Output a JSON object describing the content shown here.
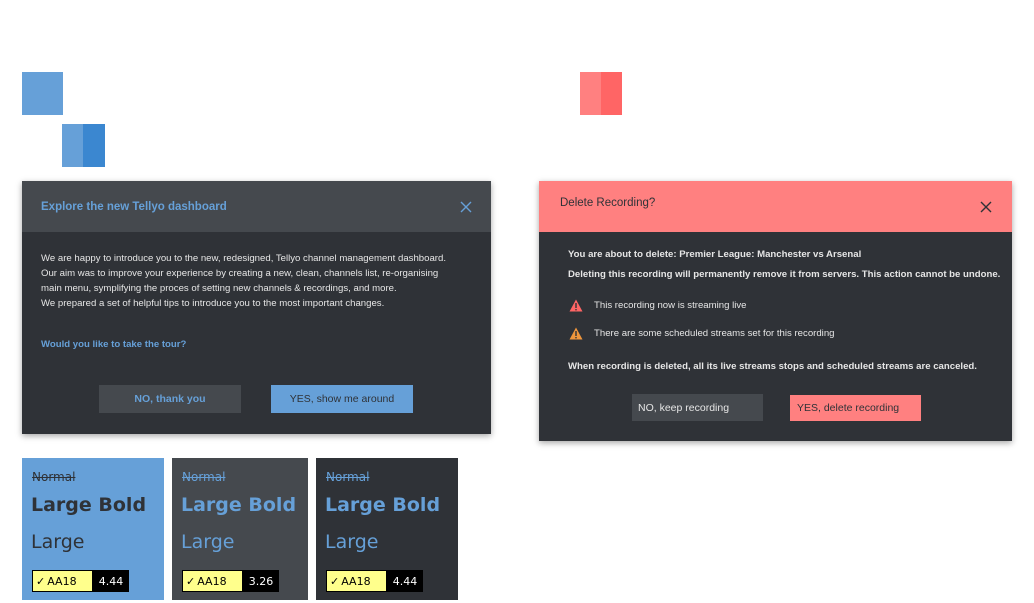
{
  "colors": {
    "accent_blue": "#66a0d8",
    "accent_blue_dark": "#3b87d0",
    "accent_red": "#ff8080",
    "accent_red_dark": "#ff6565",
    "dialog_bg": "#2f3237",
    "dialog_header_bg": "#45494e",
    "button_dark": "#45494e",
    "sample_dark": "#2f3237"
  },
  "tour_dialog": {
    "title": "Explore the new Tellyo dashboard",
    "close_icon": "close-icon",
    "paragraph_lines": [
      "We are happy to introduce you to the new, redesigned, Tellyo channel management dashboard.",
      "Our aim was to improve your experience by creating a new, clean, channels list, re-organising",
      "main menu, symplifying the proces of setting new channels & recordings, and more.",
      "We prepared a set of helpful tips to introduce you to the most important changes."
    ],
    "question": "Would you like to take the tour?",
    "decline_label": "NO, thank you",
    "accept_label": "YES, show me around"
  },
  "delete_dialog": {
    "title": "Delete Recording?",
    "close_icon": "close-icon",
    "line_1": "You are about to delete: Premier League: Manchester vs Arsenal",
    "line_2": "Deleting this recording will permanently remove it from servers. This action cannot be undone.",
    "warnings": [
      {
        "icon": "warning-icon-red",
        "text": "This recording now is streaming live"
      },
      {
        "icon": "warning-icon-orange",
        "text": "There are some scheduled streams set for this recording"
      }
    ],
    "note": "When recording is deleted, all its live streams stops and scheduled streams are canceled.",
    "cancel_label": "NO, keep recording",
    "confirm_label": "YES, delete recording"
  },
  "contrast_samples": [
    {
      "normal": "Normal",
      "large_bold": "Large Bold",
      "large": "Large",
      "badge_level": "AA18",
      "ratio": "4.44",
      "background": "#66a0d8",
      "text_color": "#2f3237"
    },
    {
      "normal": "Normal",
      "large_bold": "Large Bold",
      "large": "Large",
      "badge_level": "AA18",
      "ratio": "3.26",
      "background": "#45494e",
      "text_color": "#66a0d8"
    },
    {
      "normal": "Normal",
      "large_bold": "Large Bold",
      "large": "Large",
      "badge_level": "AA18",
      "ratio": "4.44",
      "background": "#2f3237",
      "text_color": "#66a0d8"
    }
  ]
}
